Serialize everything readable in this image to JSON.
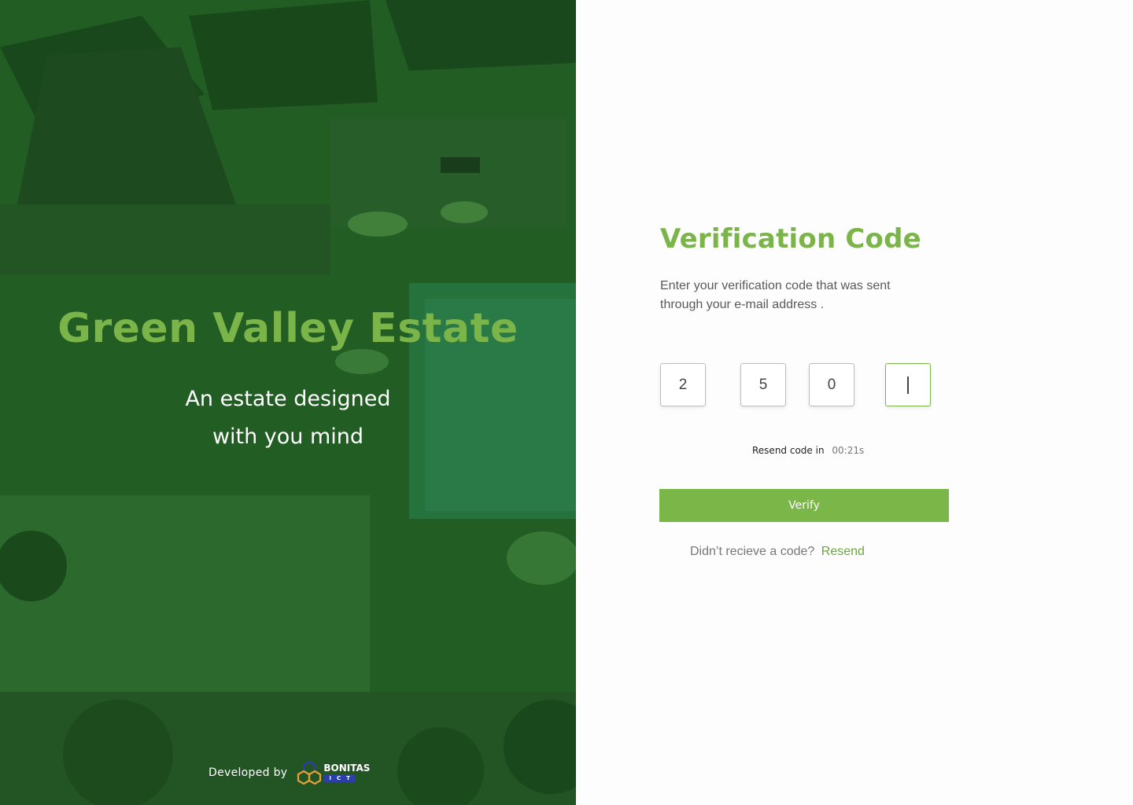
{
  "hero": {
    "title": "Green Valley Estate",
    "subtitle": "An estate designed with you mind",
    "developed_by": "Developed by",
    "brand_name": "BONITAS",
    "brand_sub": "ICT",
    "overlay_color": "#1f5a22",
    "title_color": "#7bb54a"
  },
  "form": {
    "title": "Verification Code",
    "description": "Enter your verification code that was sent through your e-mail address .",
    "code_digits": [
      "2",
      "5",
      "0",
      ""
    ],
    "resend_timer_label": "Resend code in",
    "resend_timer_value": "00:21s",
    "verify_label": "Verify",
    "no_code_text": "Didn’t recieve a code?",
    "resend_label": "Resend",
    "accent_color": "#7ab648"
  }
}
